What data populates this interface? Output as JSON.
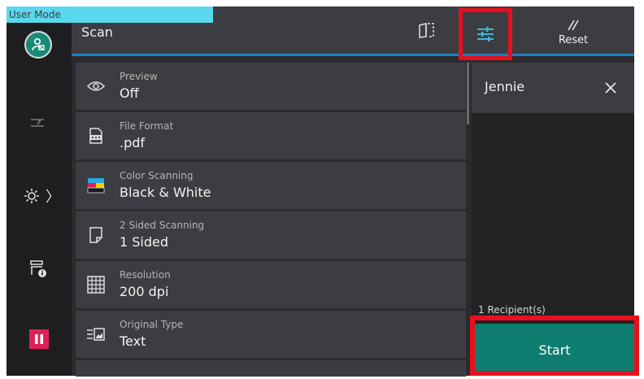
{
  "status": {
    "user_mode": "User Mode"
  },
  "header": {
    "title": "Scan",
    "reset_label": "Reset"
  },
  "settings": [
    {
      "label": "Preview",
      "value": "Off",
      "icon": "eye-icon"
    },
    {
      "label": "File Format",
      "value": ".pdf",
      "icon": "file-format-icon"
    },
    {
      "label": "Color Scanning",
      "value": "Black & White",
      "icon": "color-icon"
    },
    {
      "label": "2 Sided Scanning",
      "value": "1 Sided",
      "icon": "sided-icon"
    },
    {
      "label": "Resolution",
      "value": "200 dpi",
      "icon": "grid-icon"
    },
    {
      "label": "Original Type",
      "value": "Text",
      "icon": "original-type-icon"
    }
  ],
  "recipients": {
    "name": "Jennie",
    "count_label": "1 Recipient(s)"
  },
  "actions": {
    "start_label": "Start"
  },
  "colors": {
    "accent_blue": "#1e7fc4",
    "start_green": "#0e7d6f",
    "highlight_red": "#e8101c",
    "pause_pink": "#e01f58",
    "avatar_teal": "#1a8a7a"
  }
}
